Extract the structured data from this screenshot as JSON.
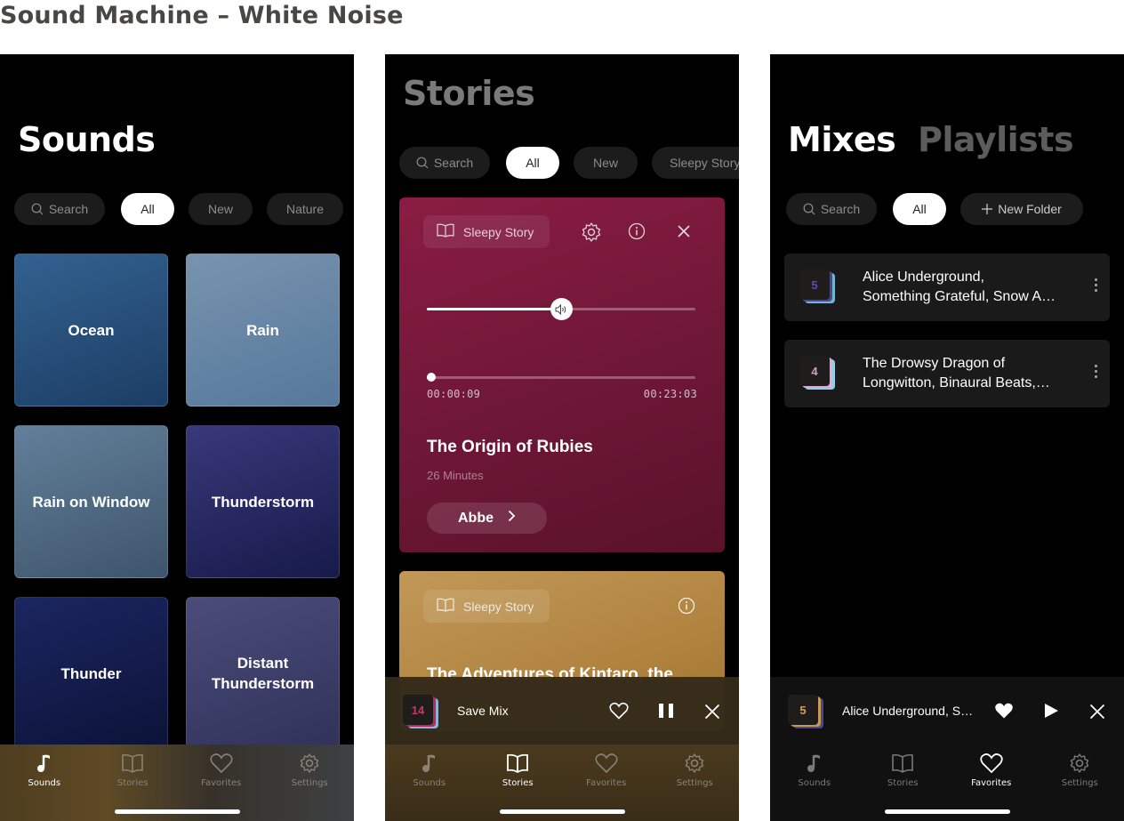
{
  "page_title": "Sound Machine – White Noise",
  "common": {
    "search_placeholder": "Search"
  },
  "tabs": [
    {
      "label": "Sounds",
      "icon": "music-note-icon"
    },
    {
      "label": "Stories",
      "icon": "book-icon"
    },
    {
      "label": "Favorites",
      "icon": "heart-icon"
    },
    {
      "label": "Settings",
      "icon": "gear-icon"
    }
  ],
  "sounds_screen": {
    "title": "Sounds",
    "filters": [
      "All",
      "New",
      "Nature"
    ],
    "active_filter": "All",
    "active_tab": "Sounds",
    "tiles": [
      {
        "label": "Ocean",
        "color": "#2a5480"
      },
      {
        "label": "Rain",
        "color": "#6a8aab"
      },
      {
        "label": "Rain on Window",
        "color": "#587590"
      },
      {
        "label": "Thunderstorm",
        "color": "#2c2a66"
      },
      {
        "label": "Thunder",
        "color": "#121c4a"
      },
      {
        "label": "Distant Thunderstorm",
        "color": "#3d3f6a"
      }
    ]
  },
  "stories_screen": {
    "title": "Stories",
    "filters": [
      "All",
      "New",
      "Sleepy Story"
    ],
    "active_filter": "All",
    "active_tab": "Stories",
    "now_playing_card": {
      "category": "Sleepy Story",
      "volume": 0.5,
      "progress": 0.007,
      "elapsed": "00:00:09",
      "remaining": "00:23:03",
      "title": "The Origin of Rubies",
      "duration": "26 Minutes",
      "narrator": "Abbe",
      "color": "#7a1a3c"
    },
    "next_card": {
      "category": "Sleepy Story",
      "title": "The Adventures of Kintaro, the",
      "color": "#b88a48"
    },
    "mini_player": {
      "count": "14",
      "label": "Save Mix",
      "state": "playing"
    }
  },
  "favorites_screen": {
    "title_active": "Mixes",
    "title_inactive": "Playlists",
    "filters": [
      "All"
    ],
    "new_folder_label": "New Folder",
    "active_filter": "All",
    "active_tab": "Favorites",
    "mixes": [
      {
        "count": "5",
        "line1": "Alice Underground,",
        "line2": "Something Grateful, Snow A…"
      },
      {
        "count": "4",
        "line1": "The Drowsy Dragon of",
        "line2": "Longwitton, Binaural Beats,…"
      }
    ],
    "mini_player": {
      "count": "5",
      "label": "Alice Underground, S…",
      "state": "paused",
      "favorited": true
    }
  }
}
